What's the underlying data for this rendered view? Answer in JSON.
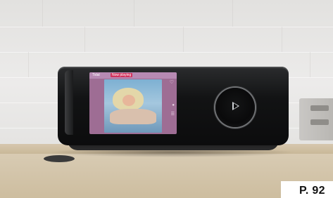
{
  "device_screen": {
    "app_logo": "Tidal",
    "app_label": "Now playing",
    "icons": [
      "heart-icon",
      "speaker-icon",
      "queue-icon"
    ]
  },
  "controls": {
    "knob_icon": "play-icon"
  },
  "page_tag": {
    "label": "P. 92"
  }
}
